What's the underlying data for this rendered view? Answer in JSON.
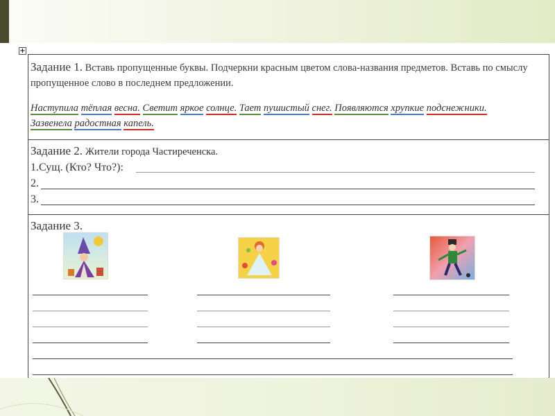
{
  "task1": {
    "title": "Задание 1.",
    "instruction": "Вставь пропущенные буквы. Подчеркни красным цветом слова-названия предметов. Вставь по смыслу пропущенное слово в последнем предложении.",
    "words": [
      "Наступила",
      "тёплая",
      "весна.",
      "Светит",
      "яркое",
      "солнце.",
      "Тает",
      "пушистый",
      "снег.",
      "Появляются",
      "хрупкие",
      "подснежники.",
      "Зазвенела",
      "радостная",
      "капель."
    ]
  },
  "task2": {
    "title": "Задание 2.",
    "subtitle": "Жители города Частиреченска.",
    "line1": "1.Сущ. (Кто? Что?):",
    "line2": "2.",
    "line3": "3."
  },
  "task3": {
    "title": "Задание 3."
  },
  "colors": {
    "green": "#5d8a3a",
    "blue": "#4a78c0",
    "red": "#cc2a2a"
  }
}
